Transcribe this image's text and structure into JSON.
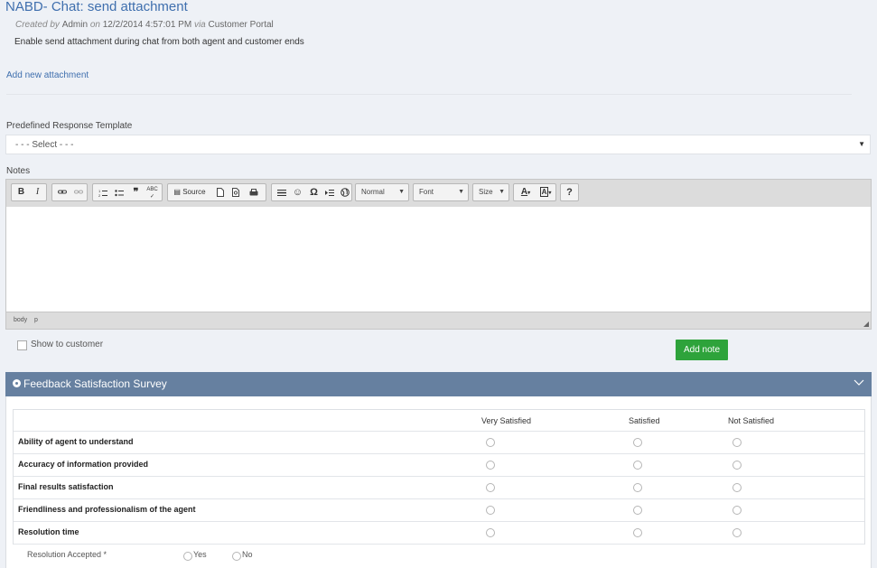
{
  "ticket": {
    "title": "NABD- Chat: send attachment",
    "meta_created_by": "Created by",
    "meta_author": "Admin",
    "meta_on": "on",
    "meta_date": "12/2/2014 4:57:01 PM",
    "meta_via": "via",
    "meta_source": "Customer Portal",
    "description": "Enable send attachment during chat from both agent and customer ends",
    "add_attachment": "Add new attachment"
  },
  "response_template": {
    "label": "Predefined Response Template",
    "selected": "- - - Select - - -"
  },
  "notes": {
    "label": "Notes",
    "toolbar": {
      "bold": "B",
      "italic": "I",
      "source": "Source",
      "format": "Normal",
      "font": "Font",
      "size": "Size",
      "help": "?"
    },
    "footer_path": [
      "body",
      "p"
    ],
    "show_to_customer": "Show to customer",
    "add_note": "Add note"
  },
  "survey": {
    "title": "Feedback Satisfaction Survey",
    "columns": [
      "Very Satisfied",
      "Satisfied",
      "Not Satisfied"
    ],
    "questions": [
      "Ability of agent to understand",
      "Accuracy of information provided",
      "Final results satisfaction",
      "Friendliness and professionalism of the agent",
      "Resolution time"
    ],
    "resolution_label": "Resolution Accepted *",
    "yes": "Yes",
    "no": "No"
  },
  "colors": {
    "link": "#3f6fae",
    "survey_header": "#6680a0",
    "add_note_button": "#2ea33b"
  }
}
